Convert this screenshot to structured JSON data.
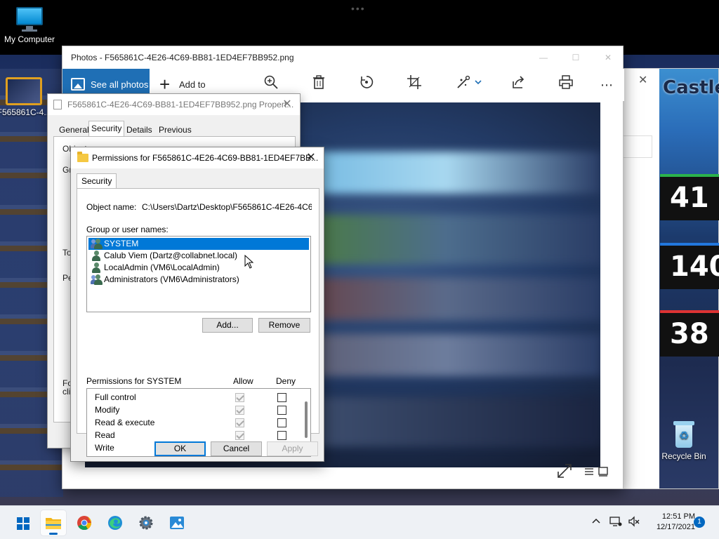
{
  "desktop": {
    "icons": [
      {
        "label": "My Computer"
      },
      {
        "label": "F565861C-4..."
      },
      {
        "label": "Recycle Bin"
      }
    ]
  },
  "game": {
    "title_fragment": "Castle",
    "scores": [
      "41",
      "140",
      "38"
    ],
    "colors": {
      "green": "#2bb34b",
      "blue": "#2277dd",
      "red": "#dd3333"
    }
  },
  "photos": {
    "title": "Photos - F565861C-4E26-4C69-BB81-1ED4EF7BB952.png",
    "toolbar": {
      "see_all_label": "See all photos",
      "add_to_label": "Add to",
      "icons": [
        "zoom-icon",
        "delete-icon",
        "rotate-icon",
        "crop-icon",
        "edit-icon",
        "share-icon",
        "print-icon",
        "more-icon"
      ]
    },
    "accent": "#1f6fb5"
  },
  "properties": {
    "title": "F565861C-4E26-4C69-BB81-1ED4EF7BB952.png Propert...",
    "tabs": [
      "General",
      "Security",
      "Details",
      "Previous Versions"
    ],
    "active_tab": "Security",
    "peek": {
      "object_name": "Object name:",
      "path_fragment": "C:\\Users\\Dartz\\Desktop\\F565861C-4E26-4C69-BB",
      "group_fragment": "Gro",
      "to_fragment": "To",
      "perm_fragment": "Pe",
      "fo_fragment": "Fo",
      "cli_fragment": "clic"
    }
  },
  "permissions": {
    "title": "Permissions for F565861C-4E26-4C69-BB81-1ED4EF7BB...",
    "tab": "Security",
    "object_name_label": "Object name:",
    "object_name_value": "C:\\Users\\Dartz\\Desktop\\F565861C-4E26-4C69-BB",
    "group_label": "Group or user names:",
    "users": [
      {
        "name": "SYSTEM",
        "type": "group",
        "selected": true
      },
      {
        "name": "Calub Viem (Dartz@collabnet.local)",
        "type": "user",
        "selected": false
      },
      {
        "name": "LocalAdmin (VM6\\LocalAdmin)",
        "type": "user",
        "selected": false
      },
      {
        "name": "Administrators (VM6\\Administrators)",
        "type": "group",
        "selected": false
      }
    ],
    "add_button": "Add...",
    "remove_button": "Remove",
    "permissions_for_label": "Permissions for SYSTEM",
    "allow_label": "Allow",
    "deny_label": "Deny",
    "rows": [
      {
        "name": "Full control",
        "allow": true,
        "deny": false
      },
      {
        "name": "Modify",
        "allow": true,
        "deny": false
      },
      {
        "name": "Read & execute",
        "allow": true,
        "deny": false
      },
      {
        "name": "Read",
        "allow": true,
        "deny": false
      },
      {
        "name": "Write",
        "allow": true,
        "deny": false
      }
    ],
    "ok_button": "OK",
    "cancel_button": "Cancel",
    "apply_button": "Apply"
  },
  "taskbar": {
    "apps": [
      "start-icon",
      "file-explorer-icon",
      "chrome-icon",
      "edge-icon",
      "settings-icon",
      "photos-icon"
    ],
    "active_app": "file-explorer-icon",
    "time": "12:51 PM",
    "date": "12/17/2021",
    "notification_count": "1",
    "accent": "#0067c0"
  }
}
